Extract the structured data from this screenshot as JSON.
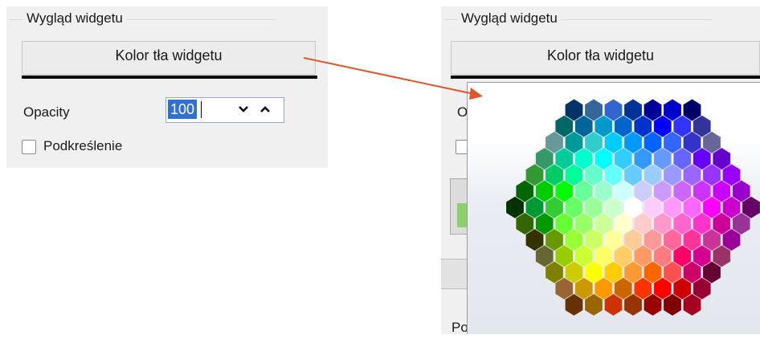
{
  "left_panel": {
    "group_title": "Wygląd widgetu",
    "background_color_button": "Kolor tła widgetu",
    "opacity_label": "Opacity",
    "opacity_value": "100",
    "underline_checkbox_label": "Podkreślenie",
    "underline_checked": false
  },
  "right_panel": {
    "group_title": "Wygląd widgetu",
    "background_color_button": "Kolor tła widgetu",
    "cut_label_fragment": "O",
    "bottom_text_fragment": "Po"
  },
  "arrow_color": "#e0552a",
  "color_picker": {
    "type": "hexagon-palette",
    "rows": [
      [
        "#003366",
        "#336699",
        "#3366cc",
        "#003399",
        "#000099",
        "#0000cc",
        "#000066"
      ],
      [
        "#006666",
        "#006699",
        "#0099cc",
        "#0066cc",
        "#0033cc",
        "#0000ff",
        "#3333ff",
        "#333399"
      ],
      [
        "#669999",
        "#009999",
        "#33cccc",
        "#00ccff",
        "#0099ff",
        "#0066ff",
        "#3366ff",
        "#3333cc",
        "#666699"
      ],
      [
        "#339966",
        "#00cc99",
        "#00ffcc",
        "#00ffff",
        "#33ccff",
        "#3399ff",
        "#6699ff",
        "#6666ff",
        "#6600ff",
        "#6600cc"
      ],
      [
        "#339933",
        "#00cc66",
        "#00ff99",
        "#66ffcc",
        "#66ffff",
        "#66ccff",
        "#99ccff",
        "#9999ff",
        "#9966ff",
        "#9933ff",
        "#9900ff"
      ],
      [
        "#006600",
        "#00cc00",
        "#00ff00",
        "#66ff99",
        "#99ffcc",
        "#ccffff",
        "#ccccff",
        "#cc99ff",
        "#cc66ff",
        "#cc33ff",
        "#cc00ff",
        "#9900cc"
      ],
      [
        "#003300",
        "#009933",
        "#33cc33",
        "#66ff66",
        "#99ff99",
        "#ccffcc",
        "#ffffff",
        "#ffccff",
        "#ff99ff",
        "#ff66ff",
        "#ff00ff",
        "#cc00cc",
        "#660066"
      ],
      [
        "#336600",
        "#009900",
        "#66ff33",
        "#99ff66",
        "#ccff99",
        "#ffffcc",
        "#ffcccc",
        "#ff99cc",
        "#ff66cc",
        "#ff33cc",
        "#cc0099",
        "#993399"
      ],
      [
        "#333300",
        "#669900",
        "#99ff33",
        "#ccff66",
        "#ffff99",
        "#ffcc99",
        "#ff9999",
        "#ff6699",
        "#ff3399",
        "#cc3399",
        "#990099"
      ],
      [
        "#666633",
        "#99cc00",
        "#ccff33",
        "#ffff66",
        "#ffcc66",
        "#ff9966",
        "#ff7c80",
        "#ff0066",
        "#d60093",
        "#993366"
      ],
      [
        "#808000",
        "#cccc00",
        "#ffff00",
        "#ffcc00",
        "#ff9933",
        "#ff6600",
        "#ff5050",
        "#cc0066",
        "#660033"
      ],
      [
        "#996633",
        "#cc9900",
        "#ff9900",
        "#cc6600",
        "#ff3300",
        "#ff0000",
        "#cc0000",
        "#990033"
      ],
      [
        "#663300",
        "#996600",
        "#cc3300",
        "#993300",
        "#990000",
        "#800000",
        "#a50021"
      ]
    ]
  }
}
